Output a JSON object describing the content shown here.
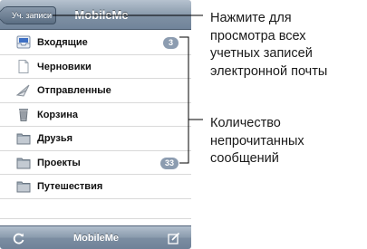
{
  "navbar": {
    "back_label": "Уч. записи",
    "title": "MobileMe"
  },
  "mailboxes": [
    {
      "label": "Входящие",
      "icon": "inbox-icon",
      "badge": "3"
    },
    {
      "label": "Черновики",
      "icon": "drafts-icon",
      "badge": ""
    },
    {
      "label": "Отправленные",
      "icon": "sent-icon",
      "badge": ""
    },
    {
      "label": "Корзина",
      "icon": "trash-icon",
      "badge": ""
    },
    {
      "label": "Друзья",
      "icon": "folder-icon",
      "badge": ""
    },
    {
      "label": "Проекты",
      "icon": "folder-icon",
      "badge": "33"
    },
    {
      "label": "Путешествия",
      "icon": "folder-icon",
      "badge": ""
    }
  ],
  "toolbar": {
    "title": "MobileMe",
    "left_icon": "refresh-icon",
    "right_icon": "compose-icon"
  },
  "callouts": {
    "accounts": "Нажмите для\nпросмотра всех\nучетных записей\nэлектронной почты",
    "unread": "Количество\nнепрочитанных\nсообщений"
  },
  "colors": {
    "bar_blue": "#8c9dae",
    "badge": "#8c9cb0"
  }
}
